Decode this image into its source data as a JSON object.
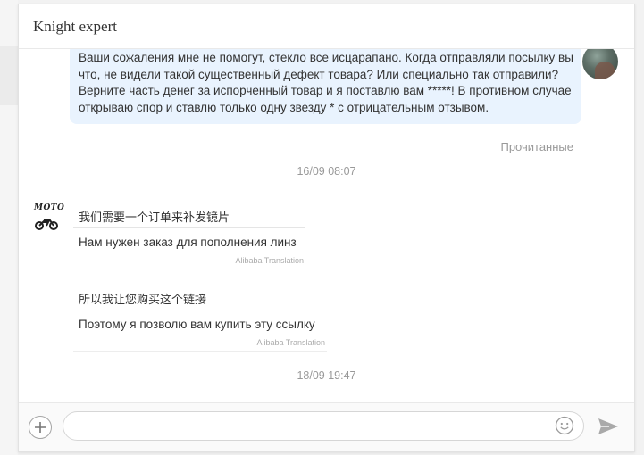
{
  "header": {
    "title": "Knight expert"
  },
  "messages": {
    "outgoing": {
      "text": "Ваши сожаления мне не помогут, стекло все исцарапано. Когда отправляли посылку вы что, не видели такой существенный дефект товара? Или специально так отправили? Верните часть денег за испорченный товар и я поставлю вам *****! В противном случае открываю спор и ставлю только одну звезду * с отрицательным отзывом.",
      "status": "Прочитанные"
    },
    "timestamp1": "16/09 08:07",
    "seller_logo": "MOTO",
    "incoming": [
      {
        "original": "我们需要一个订单来补发镜片",
        "translated": "Нам нужен заказ для пополнения линз",
        "translation_label": "Alibaba Translation"
      },
      {
        "original": "所以我让您购买这个链接",
        "translated": "Поэтому я позволю вам купить эту ссылку",
        "translation_label": "Alibaba Translation"
      }
    ],
    "timestamp2": "18/09 19:47"
  },
  "input_bar": {
    "placeholder": "",
    "add_icon": "plus-icon",
    "emoji_icon": "smiley-icon",
    "send_icon": "send-icon"
  },
  "colors": {
    "outgoing_bubble": "#e9f3fe",
    "muted_text": "#999999",
    "border": "#e2e2e2"
  }
}
